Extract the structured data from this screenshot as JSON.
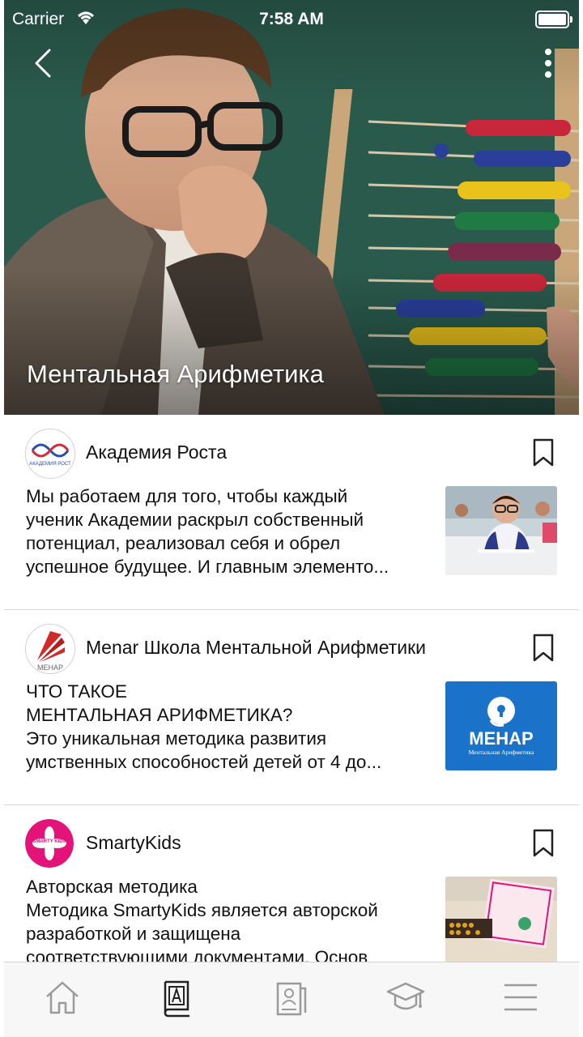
{
  "status_bar": {
    "carrier": "Carrier",
    "time": "7:58 AM"
  },
  "hero": {
    "title": "Ментальная Арифметика"
  },
  "feed": [
    {
      "name": "Академия Роста",
      "logo_text": "АКАДЕМИЯ РОСТ",
      "lines": [
        "Мы работаем для того, чтобы каждый",
        "ученик Академии раскрыл собственный",
        "потенциал, реализовал себя и обрел",
        "успешное будущее. И главным элементо..."
      ]
    },
    {
      "name": "Menar Школа Ментальной Арифметики",
      "logo_text": "МЕНАР",
      "thumb_title": "МЕНАР",
      "thumb_subtitle": "Ментальная Арифметика",
      "lines": [
        "ЧТО ТАКОЕ",
        "МЕНТАЛЬНАЯ АРИФМЕТИКА?",
        "Это уникальная методика развития",
        "умственных способностей детей от 4 до..."
      ]
    },
    {
      "name": "SmartyKids",
      "logo_text": "SMARTY KIDS",
      "lines": [
        "Авторская методика",
        "Методика SmartyKids является авторской",
        "разработкой и защищена",
        "соответствующими документами. Основ"
      ]
    }
  ],
  "icons": {
    "back": "chevron-left-icon",
    "more": "more-vertical-icon",
    "bookmark": "bookmark-icon",
    "tabs": [
      "home-icon",
      "book-icon",
      "document-icon",
      "graduation-cap-icon",
      "menu-icon"
    ]
  },
  "colors": {
    "text": "#111111",
    "tab_inactive": "#9a9a9a",
    "tab_active": "#222222",
    "menar_blue": "#1a73c9",
    "smartykids_pink": "#e3137a"
  }
}
